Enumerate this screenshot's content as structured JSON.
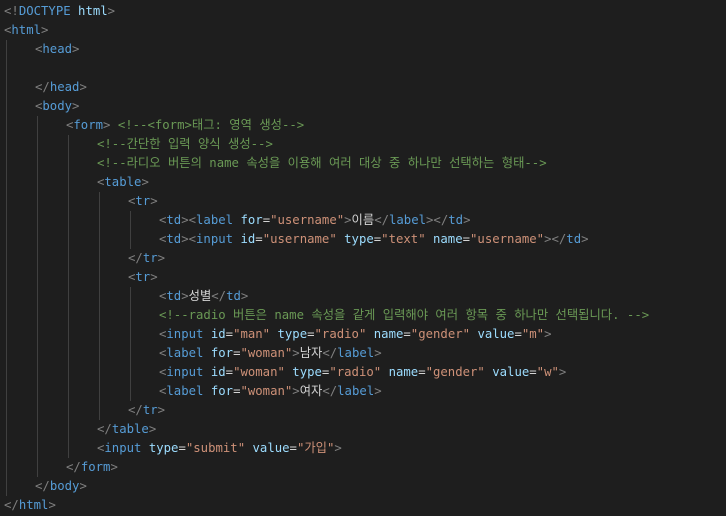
{
  "editor": {
    "colors": {
      "background": "#1e1e1e",
      "bracket": "#808080",
      "tag": "#569cd6",
      "attribute": "#9cdcfe",
      "string": "#ce9178",
      "text": "#d4d4d4",
      "comment": "#6a9955"
    },
    "lines": [
      {
        "indent": 0,
        "tokens": [
          [
            "br",
            "<!"
          ],
          [
            "tag",
            "DOCTYPE"
          ],
          [
            "txt",
            " "
          ],
          [
            "attr",
            "html"
          ],
          [
            "br",
            ">"
          ]
        ]
      },
      {
        "indent": 0,
        "tokens": [
          [
            "br",
            "<"
          ],
          [
            "tag",
            "html"
          ],
          [
            "br",
            ">"
          ]
        ]
      },
      {
        "indent": 1,
        "tokens": [
          [
            "br",
            "<"
          ],
          [
            "tag",
            "head"
          ],
          [
            "br",
            ">"
          ]
        ]
      },
      {
        "indent": 0,
        "tokens": []
      },
      {
        "indent": 1,
        "tokens": [
          [
            "br",
            "</"
          ],
          [
            "tag",
            "head"
          ],
          [
            "br",
            ">"
          ]
        ]
      },
      {
        "indent": 1,
        "tokens": [
          [
            "br",
            "<"
          ],
          [
            "tag",
            "body"
          ],
          [
            "br",
            ">"
          ]
        ]
      },
      {
        "indent": 2,
        "tokens": [
          [
            "br",
            "<"
          ],
          [
            "tag",
            "form"
          ],
          [
            "br",
            ">"
          ],
          [
            "txt",
            " "
          ],
          [
            "cmt",
            "<!--<form>태그: 영역 생성-->"
          ]
        ]
      },
      {
        "indent": 3,
        "tokens": [
          [
            "cmt",
            "<!--간단한 입력 양식 생성-->"
          ]
        ]
      },
      {
        "indent": 3,
        "tokens": [
          [
            "cmt",
            "<!--라디오 버튼의 name 속성을 이용해 여러 대상 중 하나만 선택하는 형태-->"
          ]
        ]
      },
      {
        "indent": 3,
        "tokens": [
          [
            "br",
            "<"
          ],
          [
            "tag",
            "table"
          ],
          [
            "br",
            ">"
          ]
        ]
      },
      {
        "indent": 4,
        "tokens": [
          [
            "br",
            "<"
          ],
          [
            "tag",
            "tr"
          ],
          [
            "br",
            ">"
          ]
        ]
      },
      {
        "indent": 5,
        "tokens": [
          [
            "br",
            "<"
          ],
          [
            "tag",
            "td"
          ],
          [
            "br",
            "><"
          ],
          [
            "tag",
            "label"
          ],
          [
            "txt",
            " "
          ],
          [
            "attr",
            "for"
          ],
          [
            "txt",
            "="
          ],
          [
            "str",
            "\"username\""
          ],
          [
            "br",
            ">"
          ],
          [
            "txt",
            "이름"
          ],
          [
            "br",
            "</"
          ],
          [
            "tag",
            "label"
          ],
          [
            "br",
            "></"
          ],
          [
            "tag",
            "td"
          ],
          [
            "br",
            ">"
          ]
        ]
      },
      {
        "indent": 5,
        "tokens": [
          [
            "br",
            "<"
          ],
          [
            "tag",
            "td"
          ],
          [
            "br",
            "><"
          ],
          [
            "tag",
            "input"
          ],
          [
            "txt",
            " "
          ],
          [
            "attr",
            "id"
          ],
          [
            "txt",
            "="
          ],
          [
            "str",
            "\"username\""
          ],
          [
            "txt",
            " "
          ],
          [
            "attr",
            "type"
          ],
          [
            "txt",
            "="
          ],
          [
            "str",
            "\"text\""
          ],
          [
            "txt",
            " "
          ],
          [
            "attr",
            "name"
          ],
          [
            "txt",
            "="
          ],
          [
            "str",
            "\"username\""
          ],
          [
            "br",
            "></"
          ],
          [
            "tag",
            "td"
          ],
          [
            "br",
            ">"
          ]
        ]
      },
      {
        "indent": 4,
        "tokens": [
          [
            "br",
            "</"
          ],
          [
            "tag",
            "tr"
          ],
          [
            "br",
            ">"
          ]
        ]
      },
      {
        "indent": 4,
        "tokens": [
          [
            "br",
            "<"
          ],
          [
            "tag",
            "tr"
          ],
          [
            "br",
            ">"
          ]
        ]
      },
      {
        "indent": 5,
        "tokens": [
          [
            "br",
            "<"
          ],
          [
            "tag",
            "td"
          ],
          [
            "br",
            ">"
          ],
          [
            "txt",
            "성별"
          ],
          [
            "br",
            "</"
          ],
          [
            "tag",
            "td"
          ],
          [
            "br",
            ">"
          ]
        ]
      },
      {
        "indent": 5,
        "tokens": [
          [
            "cmt",
            "<!--radio 버튼은 name 속성을 같게 입력해야 여러 항목 중 하나만 선택됩니다. -->"
          ]
        ]
      },
      {
        "indent": 5,
        "tokens": [
          [
            "br",
            "<"
          ],
          [
            "tag",
            "input"
          ],
          [
            "txt",
            " "
          ],
          [
            "attr",
            "id"
          ],
          [
            "txt",
            "="
          ],
          [
            "str",
            "\"man\""
          ],
          [
            "txt",
            " "
          ],
          [
            "attr",
            "type"
          ],
          [
            "txt",
            "="
          ],
          [
            "str",
            "\"radio\""
          ],
          [
            "txt",
            " "
          ],
          [
            "attr",
            "name"
          ],
          [
            "txt",
            "="
          ],
          [
            "str",
            "\"gender\""
          ],
          [
            "txt",
            " "
          ],
          [
            "attr",
            "value"
          ],
          [
            "txt",
            "="
          ],
          [
            "str",
            "\"m\""
          ],
          [
            "br",
            ">"
          ]
        ]
      },
      {
        "indent": 5,
        "tokens": [
          [
            "br",
            "<"
          ],
          [
            "tag",
            "label"
          ],
          [
            "txt",
            " "
          ],
          [
            "attr",
            "for"
          ],
          [
            "txt",
            "="
          ],
          [
            "str",
            "\"woman\""
          ],
          [
            "br",
            ">"
          ],
          [
            "txt",
            "남자"
          ],
          [
            "br",
            "</"
          ],
          [
            "tag",
            "label"
          ],
          [
            "br",
            ">"
          ]
        ]
      },
      {
        "indent": 5,
        "tokens": [
          [
            "br",
            "<"
          ],
          [
            "tag",
            "input"
          ],
          [
            "txt",
            " "
          ],
          [
            "attr",
            "id"
          ],
          [
            "txt",
            "="
          ],
          [
            "str",
            "\"woman\""
          ],
          [
            "txt",
            " "
          ],
          [
            "attr",
            "type"
          ],
          [
            "txt",
            "="
          ],
          [
            "str",
            "\"radio\""
          ],
          [
            "txt",
            " "
          ],
          [
            "attr",
            "name"
          ],
          [
            "txt",
            "="
          ],
          [
            "str",
            "\"gender\""
          ],
          [
            "txt",
            " "
          ],
          [
            "attr",
            "value"
          ],
          [
            "txt",
            "="
          ],
          [
            "str",
            "\"w\""
          ],
          [
            "br",
            ">"
          ]
        ]
      },
      {
        "indent": 5,
        "tokens": [
          [
            "br",
            "<"
          ],
          [
            "tag",
            "label"
          ],
          [
            "txt",
            " "
          ],
          [
            "attr",
            "for"
          ],
          [
            "txt",
            "="
          ],
          [
            "str",
            "\"woman\""
          ],
          [
            "br",
            ">"
          ],
          [
            "txt",
            "여자"
          ],
          [
            "br",
            "</"
          ],
          [
            "tag",
            "label"
          ],
          [
            "br",
            ">"
          ]
        ]
      },
      {
        "indent": 4,
        "tokens": [
          [
            "br",
            "</"
          ],
          [
            "tag",
            "tr"
          ],
          [
            "br",
            ">"
          ]
        ]
      },
      {
        "indent": 3,
        "tokens": [
          [
            "br",
            "</"
          ],
          [
            "tag",
            "table"
          ],
          [
            "br",
            ">"
          ]
        ]
      },
      {
        "indent": 3,
        "tokens": [
          [
            "br",
            "<"
          ],
          [
            "tag",
            "input"
          ],
          [
            "txt",
            " "
          ],
          [
            "attr",
            "type"
          ],
          [
            "txt",
            "="
          ],
          [
            "str",
            "\"submit\""
          ],
          [
            "txt",
            " "
          ],
          [
            "attr",
            "value"
          ],
          [
            "txt",
            "="
          ],
          [
            "str",
            "\"가입\""
          ],
          [
            "br",
            ">"
          ]
        ]
      },
      {
        "indent": 2,
        "tokens": [
          [
            "br",
            "</"
          ],
          [
            "tag",
            "form"
          ],
          [
            "br",
            ">"
          ]
        ]
      },
      {
        "indent": 1,
        "tokens": [
          [
            "br",
            "</"
          ],
          [
            "tag",
            "body"
          ],
          [
            "br",
            ">"
          ]
        ]
      },
      {
        "indent": 0,
        "tokens": [
          [
            "br",
            "</"
          ],
          [
            "tag",
            "html"
          ],
          [
            "br",
            ">"
          ]
        ]
      }
    ]
  }
}
